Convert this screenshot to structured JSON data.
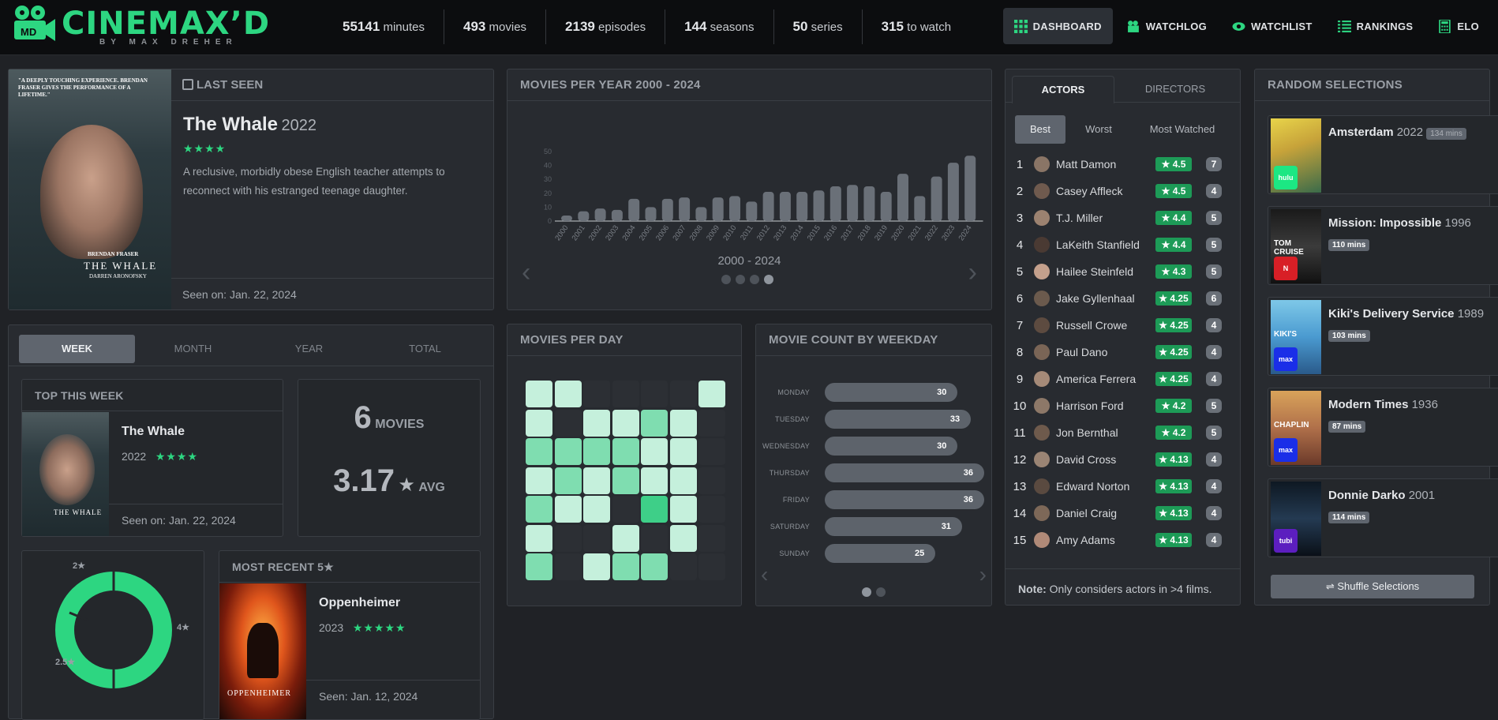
{
  "brand": {
    "name": "CINEMAX’D",
    "byline": "BY MAX DREHER",
    "badge": "MD"
  },
  "stats": [
    {
      "value": "55141",
      "unit": "minutes"
    },
    {
      "value": "493",
      "unit": "movies"
    },
    {
      "value": "2139",
      "unit": "episodes"
    },
    {
      "value": "144",
      "unit": "seasons"
    },
    {
      "value": "50",
      "unit": "series"
    },
    {
      "value": "315",
      "unit": "to watch"
    }
  ],
  "nav": [
    {
      "label": "DASHBOARD",
      "icon": "grid-icon",
      "active": true
    },
    {
      "label": "WATCHLOG",
      "icon": "film-camera-icon"
    },
    {
      "label": "WATCHLIST",
      "icon": "eye-icon"
    },
    {
      "label": "RANKINGS",
      "icon": "list-icon"
    },
    {
      "label": "ELO",
      "icon": "calculator-icon"
    }
  ],
  "last_seen": {
    "header": "LAST SEEN",
    "title": "The Whale",
    "year": "2022",
    "stars": "★★★★",
    "description": "A reclusive, morbidly obese English teacher attempts to reconnect with his estranged teenage daughter.",
    "seen": "Seen on: Jan. 22, 2024",
    "poster_quote": "\"A DEEPLY TOUCHING EXPERIENCE. BRENDAN FRASER GIVES THE PERFORMANCE OF A LIFETIME.\"",
    "poster_actor": "BRENDAN FRASER",
    "poster_title": "THE WHALE",
    "poster_director": "DARREN ARONOFSKY"
  },
  "movies_per_year": {
    "header": "MOVIES PER YEAR 2000 - 2024",
    "range_label": "2000 - 2024",
    "y_ticks": [
      "0",
      "10",
      "20",
      "30",
      "40",
      "50"
    ]
  },
  "chart_data": {
    "type": "bar",
    "title": "MOVIES PER YEAR 2000 - 2024",
    "categories": [
      "2000",
      "2001",
      "2002",
      "2003",
      "2004",
      "2005",
      "2006",
      "2007",
      "2008",
      "2009",
      "2010",
      "2011",
      "2012",
      "2013",
      "2014",
      "2015",
      "2016",
      "2017",
      "2018",
      "2019",
      "2020",
      "2021",
      "2022",
      "2023",
      "2024"
    ],
    "values": [
      4,
      7,
      9,
      8,
      16,
      10,
      16,
      17,
      10,
      17,
      18,
      14,
      21,
      21,
      21,
      22,
      25,
      26,
      25,
      21,
      34,
      18,
      32,
      42,
      47
    ],
    "ylim": [
      0,
      50
    ],
    "grid": false
  },
  "period_tabs": {
    "tabs": [
      "WEEK",
      "MONTH",
      "YEAR",
      "TOTAL"
    ],
    "active": "WEEK"
  },
  "top_this_week": {
    "header": "TOP THIS WEEK",
    "title": "The Whale",
    "year": "2022",
    "stars": "★★★★",
    "seen": "Seen on: Jan. 22, 2024"
  },
  "week_summary": {
    "movie_count": "6",
    "movies_label": "MOVIES",
    "avg": "3.17",
    "avg_star": "★",
    "avg_label": "AVG"
  },
  "rating_donut": {
    "labels": [
      {
        "label": "2★",
        "fraction": 0.05
      },
      {
        "label": "4★",
        "fraction": 0.5
      },
      {
        "label": "2.5★",
        "fraction": 0.45
      }
    ],
    "color": "#2dd681"
  },
  "most_recent_5": {
    "header": "MOST RECENT 5★",
    "title": "Oppenheimer",
    "year": "2023",
    "stars": "★★★★★",
    "seen": "Seen: Jan. 12, 2024",
    "poster_title": "OPPENHEIMER"
  },
  "movies_per_day": {
    "header": "MOVIES PER DAY",
    "levels": [
      [
        1,
        1,
        0,
        0,
        0,
        0,
        1
      ],
      [
        1,
        0,
        1,
        1,
        2,
        1,
        0
      ],
      [
        2,
        2,
        2,
        2,
        1,
        1,
        0
      ],
      [
        1,
        2,
        1,
        2,
        1,
        1,
        0
      ],
      [
        2,
        1,
        1,
        0,
        3,
        1,
        0
      ],
      [
        1,
        0,
        0,
        1,
        0,
        1,
        0
      ],
      [
        2,
        0,
        1,
        2,
        2,
        0,
        0
      ]
    ],
    "colors": [
      "#2c2f34",
      "#c5f0dc",
      "#7fddb0",
      "#3ecf88"
    ]
  },
  "weekday": {
    "header": "MOVIE COUNT BY WEEKDAY",
    "rows": [
      {
        "day": "MONDAY",
        "count": "30",
        "value": 30
      },
      {
        "day": "TUESDAY",
        "count": "33",
        "value": 33
      },
      {
        "day": "WEDNESDAY",
        "count": "30",
        "value": 30
      },
      {
        "day": "THURSDAY",
        "count": "36",
        "value": 36
      },
      {
        "day": "FRIDAY",
        "count": "36",
        "value": 36
      },
      {
        "day": "SATURDAY",
        "count": "31",
        "value": 31
      },
      {
        "day": "SUNDAY",
        "count": "25",
        "value": 25
      }
    ]
  },
  "people": {
    "tabs": [
      "ACTORS",
      "DIRECTORS"
    ],
    "active_tab": "ACTORS",
    "filters": [
      "Best",
      "Worst",
      "Most Watched"
    ],
    "active_filter": "Best",
    "rows": [
      {
        "rank": "1",
        "name": "Matt Damon",
        "score": "★ 4.5",
        "count": "7"
      },
      {
        "rank": "2",
        "name": "Casey Affleck",
        "score": "★ 4.5",
        "count": "4"
      },
      {
        "rank": "3",
        "name": "T.J. Miller",
        "score": "★ 4.4",
        "count": "5"
      },
      {
        "rank": "4",
        "name": "LaKeith Stanfield",
        "score": "★ 4.4",
        "count": "5"
      },
      {
        "rank": "5",
        "name": "Hailee Steinfeld",
        "score": "★ 4.3",
        "count": "5"
      },
      {
        "rank": "6",
        "name": "Jake Gyllenhaal",
        "score": "★ 4.25",
        "count": "6"
      },
      {
        "rank": "7",
        "name": "Russell Crowe",
        "score": "★ 4.25",
        "count": "4"
      },
      {
        "rank": "8",
        "name": "Paul Dano",
        "score": "★ 4.25",
        "count": "4"
      },
      {
        "rank": "9",
        "name": "America Ferrera",
        "score": "★ 4.25",
        "count": "4"
      },
      {
        "rank": "10",
        "name": "Harrison Ford",
        "score": "★ 4.2",
        "count": "5"
      },
      {
        "rank": "11",
        "name": "Jon Bernthal",
        "score": "★ 4.2",
        "count": "5"
      },
      {
        "rank": "12",
        "name": "David Cross",
        "score": "★ 4.13",
        "count": "4"
      },
      {
        "rank": "13",
        "name": "Edward Norton",
        "score": "★ 4.13",
        "count": "4"
      },
      {
        "rank": "14",
        "name": "Daniel Craig",
        "score": "★ 4.13",
        "count": "4"
      },
      {
        "rank": "15",
        "name": "Amy Adams",
        "score": "★ 4.13",
        "count": "4"
      }
    ],
    "note_bold": "Note:",
    "note": " Only considers actors in >4 films."
  },
  "random": {
    "header": "RANDOM SELECTIONS",
    "items": [
      {
        "title": "Amsterdam",
        "year": "2022",
        "mins": "134 mins",
        "service": "hulu",
        "service_color": "#1ce783"
      },
      {
        "title": "Mission: Impossible",
        "year": "1996",
        "mins": "110 mins",
        "service": "N",
        "service_color": "#d81f26"
      },
      {
        "title": "Kiki's Delivery Service",
        "year": "1989",
        "mins": "103 mins",
        "service": "max",
        "service_color": "#1a2ee8"
      },
      {
        "title": "Modern Times",
        "year": "1936",
        "mins": "87 mins",
        "service": "max",
        "service_color": "#1a2ee8"
      },
      {
        "title": "Donnie Darko",
        "year": "2001",
        "mins": "114 mins",
        "service": "tubi",
        "service_color": "#5c1ebf"
      }
    ],
    "shuffle_label": "Shuffle Selections",
    "poster_texts": [
      "",
      "TOM CRUISE",
      "KIKI'S",
      "CHAPLIN",
      ""
    ]
  }
}
